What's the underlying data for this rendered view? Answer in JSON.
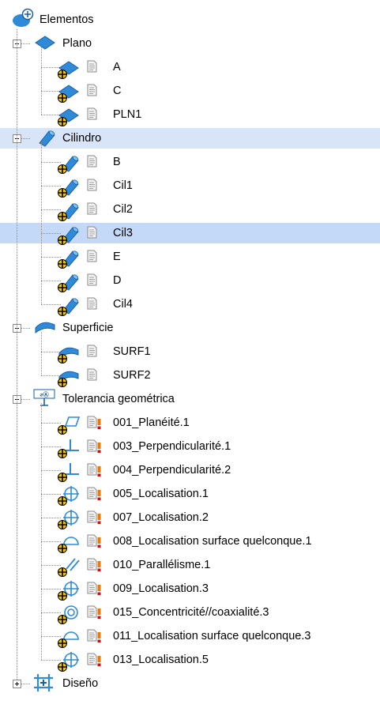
{
  "root": {
    "label": "Elementos",
    "icon": "features-root-icon"
  },
  "groups": [
    {
      "id": "plano",
      "label": "Plano",
      "icon": "plane-feature-icon",
      "expanded": true,
      "children": [
        {
          "label": "A",
          "icon": "plane-feature-icon"
        },
        {
          "label": "C",
          "icon": "plane-feature-icon"
        },
        {
          "label": "PLN1",
          "icon": "plane-feature-icon"
        }
      ]
    },
    {
      "id": "cilindro",
      "label": "Cilindro",
      "icon": "cylinder-feature-icon",
      "expanded": true,
      "highlighted": true,
      "children": [
        {
          "label": "B",
          "icon": "cylinder-feature-icon"
        },
        {
          "label": "Cil1",
          "icon": "cylinder-feature-icon"
        },
        {
          "label": "Cil2",
          "icon": "cylinder-feature-icon"
        },
        {
          "label": "Cil3",
          "icon": "cylinder-feature-icon",
          "selected": true
        },
        {
          "label": "E",
          "icon": "cylinder-feature-icon"
        },
        {
          "label": "D",
          "icon": "cylinder-feature-icon"
        },
        {
          "label": "Cil4",
          "icon": "cylinder-feature-icon"
        }
      ]
    },
    {
      "id": "superficie",
      "label": "Superficie",
      "icon": "surface-feature-icon",
      "expanded": true,
      "children": [
        {
          "label": "SURF1",
          "icon": "surface-feature-icon"
        },
        {
          "label": "SURF2",
          "icon": "surface-feature-icon"
        }
      ]
    },
    {
      "id": "tolerancia",
      "label": "Tolerancia geométrica",
      "icon": "gdt-icon",
      "expanded": true,
      "children": [
        {
          "label": "001_Planéité.1",
          "icon": "flatness-icon",
          "warning": true
        },
        {
          "label": "003_Perpendicularité.1",
          "icon": "perpendicularity-icon",
          "warning": true
        },
        {
          "label": "004_Perpendicularité.2",
          "icon": "perpendicularity-icon",
          "warning": true
        },
        {
          "label": "005_Localisation.1",
          "icon": "position-icon",
          "warning": true
        },
        {
          "label": "007_Localisation.2",
          "icon": "position-icon",
          "warning": true
        },
        {
          "label": "008_Localisation surface quelconque.1",
          "icon": "surface-profile-icon",
          "warning": true
        },
        {
          "label": "010_Parallélisme.1",
          "icon": "parallelism-icon",
          "warning": true
        },
        {
          "label": "009_Localisation.3",
          "icon": "position-icon",
          "warning": true
        },
        {
          "label": "015_Concentricité//coaxialité.3",
          "icon": "concentricity-icon",
          "warning": true
        },
        {
          "label": "011_Localisation surface quelconque.3",
          "icon": "surface-profile-icon",
          "warning": true
        },
        {
          "label": "013_Localisation.5",
          "icon": "position-icon",
          "warning": true
        }
      ]
    },
    {
      "id": "diseno",
      "label": "Diseño",
      "icon": "design-icon",
      "expanded": false,
      "children": []
    }
  ],
  "colors": {
    "feature_blue": "#2f8ad8",
    "feature_dark": "#1a5fa6",
    "highlight": "#d8e4f8",
    "selection": "#c4d8f7",
    "warning_orange": "#e8790f",
    "warning_red": "#d01010"
  }
}
